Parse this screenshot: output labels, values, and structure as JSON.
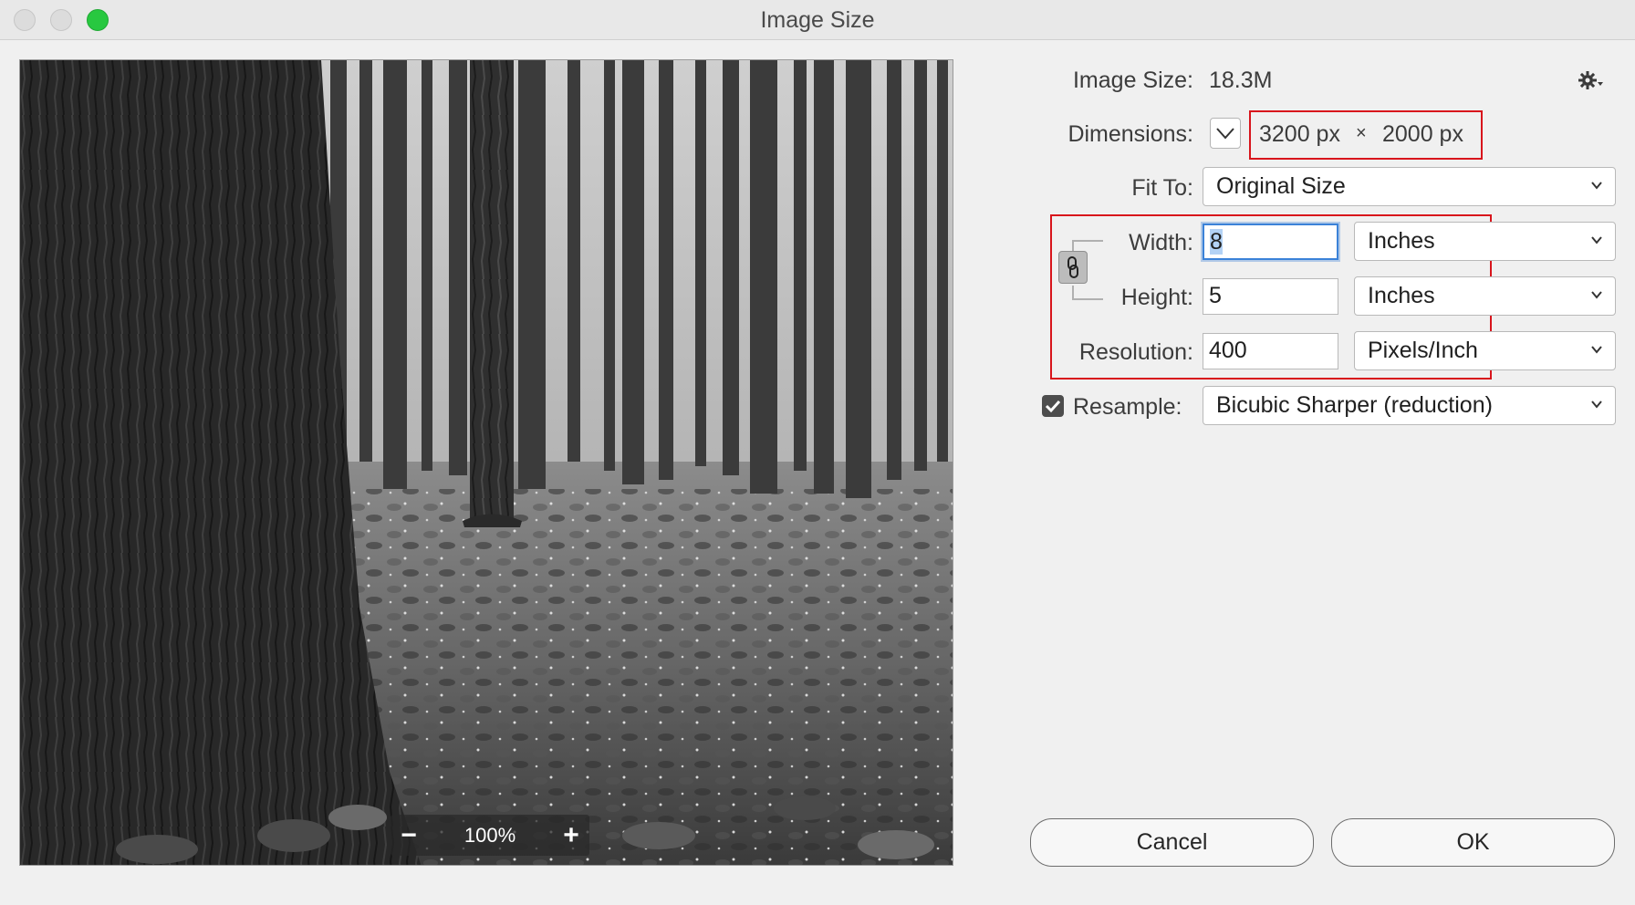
{
  "window": {
    "title": "Image Size"
  },
  "preview": {
    "zoom_level": "100%",
    "zoom_out": "−",
    "zoom_in": "+"
  },
  "image_size": {
    "label": "Image Size:",
    "value": "18.3M"
  },
  "dimensions": {
    "label": "Dimensions:",
    "width": "3200 px",
    "times": "×",
    "height": "2000 px"
  },
  "fit_to": {
    "label": "Fit To:",
    "value": "Original Size"
  },
  "width": {
    "label": "Width:",
    "value": "8",
    "unit": "Inches"
  },
  "height": {
    "label": "Height:",
    "value": "5",
    "unit": "Inches"
  },
  "resolution": {
    "label": "Resolution:",
    "value": "400",
    "unit": "Pixels/Inch"
  },
  "resample": {
    "label": "Resample:",
    "checked": true,
    "value": "Bicubic Sharper (reduction)"
  },
  "buttons": {
    "cancel": "Cancel",
    "ok": "OK"
  },
  "colors": {
    "highlight_box": "#d8151c",
    "focus_ring": "#3b82d8",
    "close_green": "#28c840"
  }
}
